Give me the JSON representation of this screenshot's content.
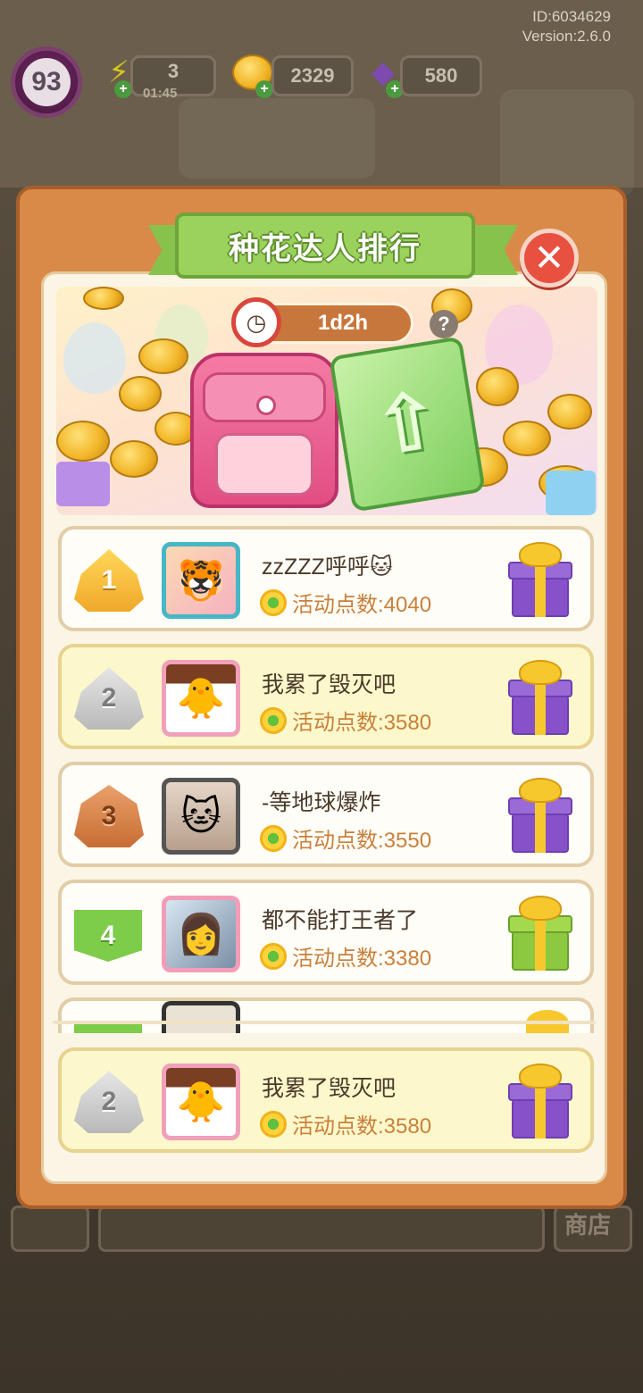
{
  "header": {
    "id_text": "ID:6034629",
    "version_text": "Version:2.6.0",
    "level": "93",
    "energy": "3",
    "energy_timer": "01:45",
    "coins": "2329",
    "gems": "580"
  },
  "panel": {
    "title": "种花达人排行",
    "timer": "1d2h",
    "help_symbol": "?"
  },
  "rankings": [
    {
      "rank": "1",
      "name": "zzZZZ呼呼🐱",
      "points": "活动点数:4040",
      "gift": "purple"
    },
    {
      "rank": "2",
      "name": "我累了毁灭吧",
      "points": "活动点数:3580",
      "gift": "purple"
    },
    {
      "rank": "3",
      "name": "-等地球爆炸",
      "points": "活动点数:3550",
      "gift": "purple"
    },
    {
      "rank": "4",
      "name": "都不能打王者了",
      "points": "活动点数:3380",
      "gift": "green"
    }
  ],
  "my_rank": {
    "rank": "2",
    "name": "我累了毁灭吧",
    "points": "活动点数:3580",
    "gift": "purple"
  },
  "background": {
    "shop_label": "商店"
  },
  "colors": {
    "panel_orange": "#d98a48",
    "title_green": "#9bd25c",
    "close_red": "#e8503f",
    "points_orange": "#c9803b"
  },
  "icons": {
    "energy": "lightning-icon",
    "coins": "coin-icon",
    "gems": "gem-icon",
    "close": "close-icon",
    "timer": "clock-icon",
    "help": "help-icon",
    "points": "flower-icon",
    "reward": "gift-box-icon"
  }
}
